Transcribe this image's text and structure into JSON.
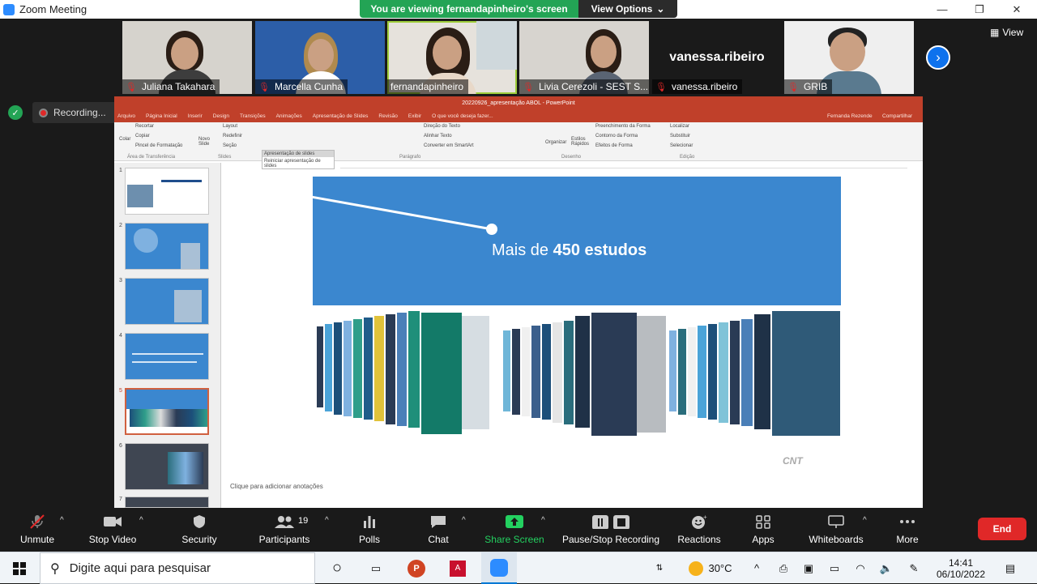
{
  "window": {
    "title": "Zoom Meeting"
  },
  "banner": {
    "text": "You are viewing fernandapinheiro's screen",
    "view_options": "View Options"
  },
  "video_strip": {
    "tiles": [
      {
        "name": "Juliana Takahara"
      },
      {
        "name": "Marcella Cunha"
      },
      {
        "name": "fernandapinheiro"
      },
      {
        "name": "Livia Cerezoli - SEST S..."
      },
      {
        "name": "vanessa.ribeiro",
        "big_name": "vanessa.ribeiro"
      },
      {
        "name": "GRIB"
      }
    ],
    "view_label": "View"
  },
  "recording": {
    "label": "Recording..."
  },
  "ppt": {
    "title": "20220926_apresentação ABOL - PowerPoint",
    "user": "Fernanda Rezende",
    "share": "Compartilhar",
    "tabs": [
      "Arquivo",
      "Página Inicial",
      "Inserir",
      "Design",
      "Transições",
      "Animações",
      "Apresentação de Slides",
      "Revisão",
      "Exibir",
      "O que você deseja fazer..."
    ],
    "ribbon": {
      "clipboard": [
        "Recortar",
        "Copiar",
        "Pincel de Formatação"
      ],
      "paste": "Colar",
      "new_slide": "Novo Slide",
      "slide_opts": [
        "Layout",
        "Redefinir",
        "Seção"
      ],
      "text_direction": [
        "Direção do Texto",
        "Alinhar Texto",
        "Converter em SmartArt"
      ],
      "arrange": "Organizar",
      "quick_styles": "Estilos Rápidos",
      "shape_format": [
        "Preenchimento da Forma",
        "Contorno da Forma",
        "Efeitos de Forma"
      ],
      "editing": [
        "Localizar",
        "Substituir",
        "Selecionar"
      ],
      "groups": [
        "Área de Transferência",
        "Slides",
        "Parágrafo",
        "Desenho",
        "Edição"
      ],
      "tooltip_title": "Apresentação de slides",
      "tooltip_item": "Reiniciar apresentação de slides"
    },
    "slide": {
      "prefix": "Mais de ",
      "bold": "450 estudos"
    },
    "notes": "Clique para adicionar anotações",
    "thumbnails": [
      "1",
      "2",
      "3",
      "4",
      "5",
      "6",
      "7"
    ]
  },
  "toolbar": {
    "unmute": "Unmute",
    "stop_video": "Stop Video",
    "security": "Security",
    "participants": "Participants",
    "participants_count": "19",
    "polls": "Polls",
    "chat": "Chat",
    "share_screen": "Share Screen",
    "pause_recording": "Pause/Stop Recording",
    "reactions": "Reactions",
    "apps": "Apps",
    "whiteboards": "Whiteboards",
    "more": "More",
    "end": "End"
  },
  "taskbar": {
    "search_placeholder": "Digite aqui para pesquisar",
    "temperature": "30°C",
    "time": "14:41",
    "date": "06/10/2022"
  },
  "colors": {
    "zoom_blue": "#2d8cff",
    "green": "#23a455",
    "end_red": "#e02828",
    "ppt_red": "#c0402a",
    "slide_blue": "#3b87cf"
  }
}
